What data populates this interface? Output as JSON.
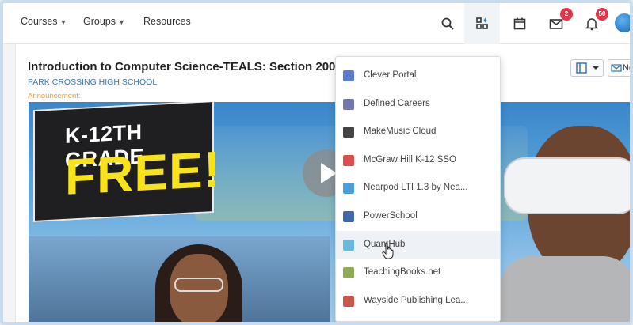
{
  "nav": {
    "courses": "Courses",
    "groups": "Groups",
    "resources": "Resources",
    "messages_count": "2",
    "notifications_count": "50"
  },
  "course": {
    "title": "Introduction to Computer Science-TEALS: Section 200",
    "school": "PARK CROSSING HIGH SCHOOL",
    "announcement_label": "Announcement:",
    "tool_button_partial": "No"
  },
  "banner": {
    "line1": "K-12TH GRADE",
    "line2": "FREE!"
  },
  "apps_menu": [
    {
      "label": "Clever Portal",
      "icon": "clever-icon",
      "color": "#3e66c9"
    },
    {
      "label": "Defined Careers",
      "icon": "defined-careers-icon",
      "color": "#5a5f9c"
    },
    {
      "label": "MakeMusic Cloud",
      "icon": "makemusic-icon",
      "color": "#222222"
    },
    {
      "label": "McGraw Hill K-12 SSO",
      "icon": "mcgraw-hill-icon",
      "color": "#d32f2f"
    },
    {
      "label": "Nearpod LTI 1.3 by Nea...",
      "icon": "nearpod-icon",
      "color": "#2b8fd6"
    },
    {
      "label": "PowerSchool",
      "icon": "powerschool-icon",
      "color": "#1e4f9c"
    },
    {
      "label": "QuantHub",
      "icon": "quanthub-icon",
      "color": "#4fb0d8"
    },
    {
      "label": "TeachingBooks.net",
      "icon": "teachingbooks-icon",
      "color": "#7a9a3a"
    },
    {
      "label": "Wayside Publishing Lea...",
      "icon": "wayside-icon",
      "color": "#c0392b"
    }
  ],
  "colors": {
    "accent": "#3a76b3",
    "badge": "#e2344a",
    "announcement": "#f29a2b"
  }
}
